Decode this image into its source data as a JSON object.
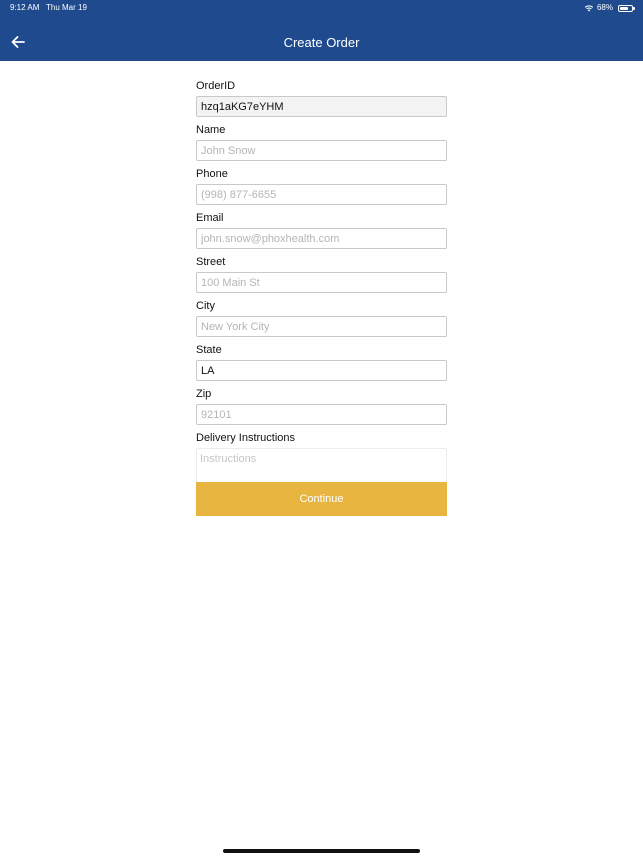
{
  "status_bar": {
    "time": "9:12 AM",
    "date": "Thu Mar 19",
    "battery": "68%",
    "battery_level": 0.68
  },
  "header": {
    "title": "Create Order",
    "back_icon": "arrow-left-icon",
    "background_color": "#1f4b8e"
  },
  "form": {
    "fields": [
      {
        "label": "OrderID",
        "value": "hzq1aKG7eYHM",
        "placeholder": ""
      },
      {
        "label": "Name",
        "value": "",
        "placeholder": "John Snow"
      },
      {
        "label": "Phone",
        "value": "",
        "placeholder": "(998) 877-6655"
      },
      {
        "label": "Email",
        "value": "",
        "placeholder": "john.snow@phoxhealth.com"
      },
      {
        "label": "Street",
        "value": "",
        "placeholder": "100 Main St"
      },
      {
        "label": "City",
        "value": "",
        "placeholder": "New York City"
      },
      {
        "label": "State",
        "value": "LA",
        "placeholder": ""
      },
      {
        "label": "Zip",
        "value": "",
        "placeholder": "92101"
      }
    ],
    "instructions": {
      "label": "Delivery Instructions",
      "placeholder": "Instructions"
    },
    "continue_label": "Continue",
    "continue_color": "#e8b640"
  }
}
